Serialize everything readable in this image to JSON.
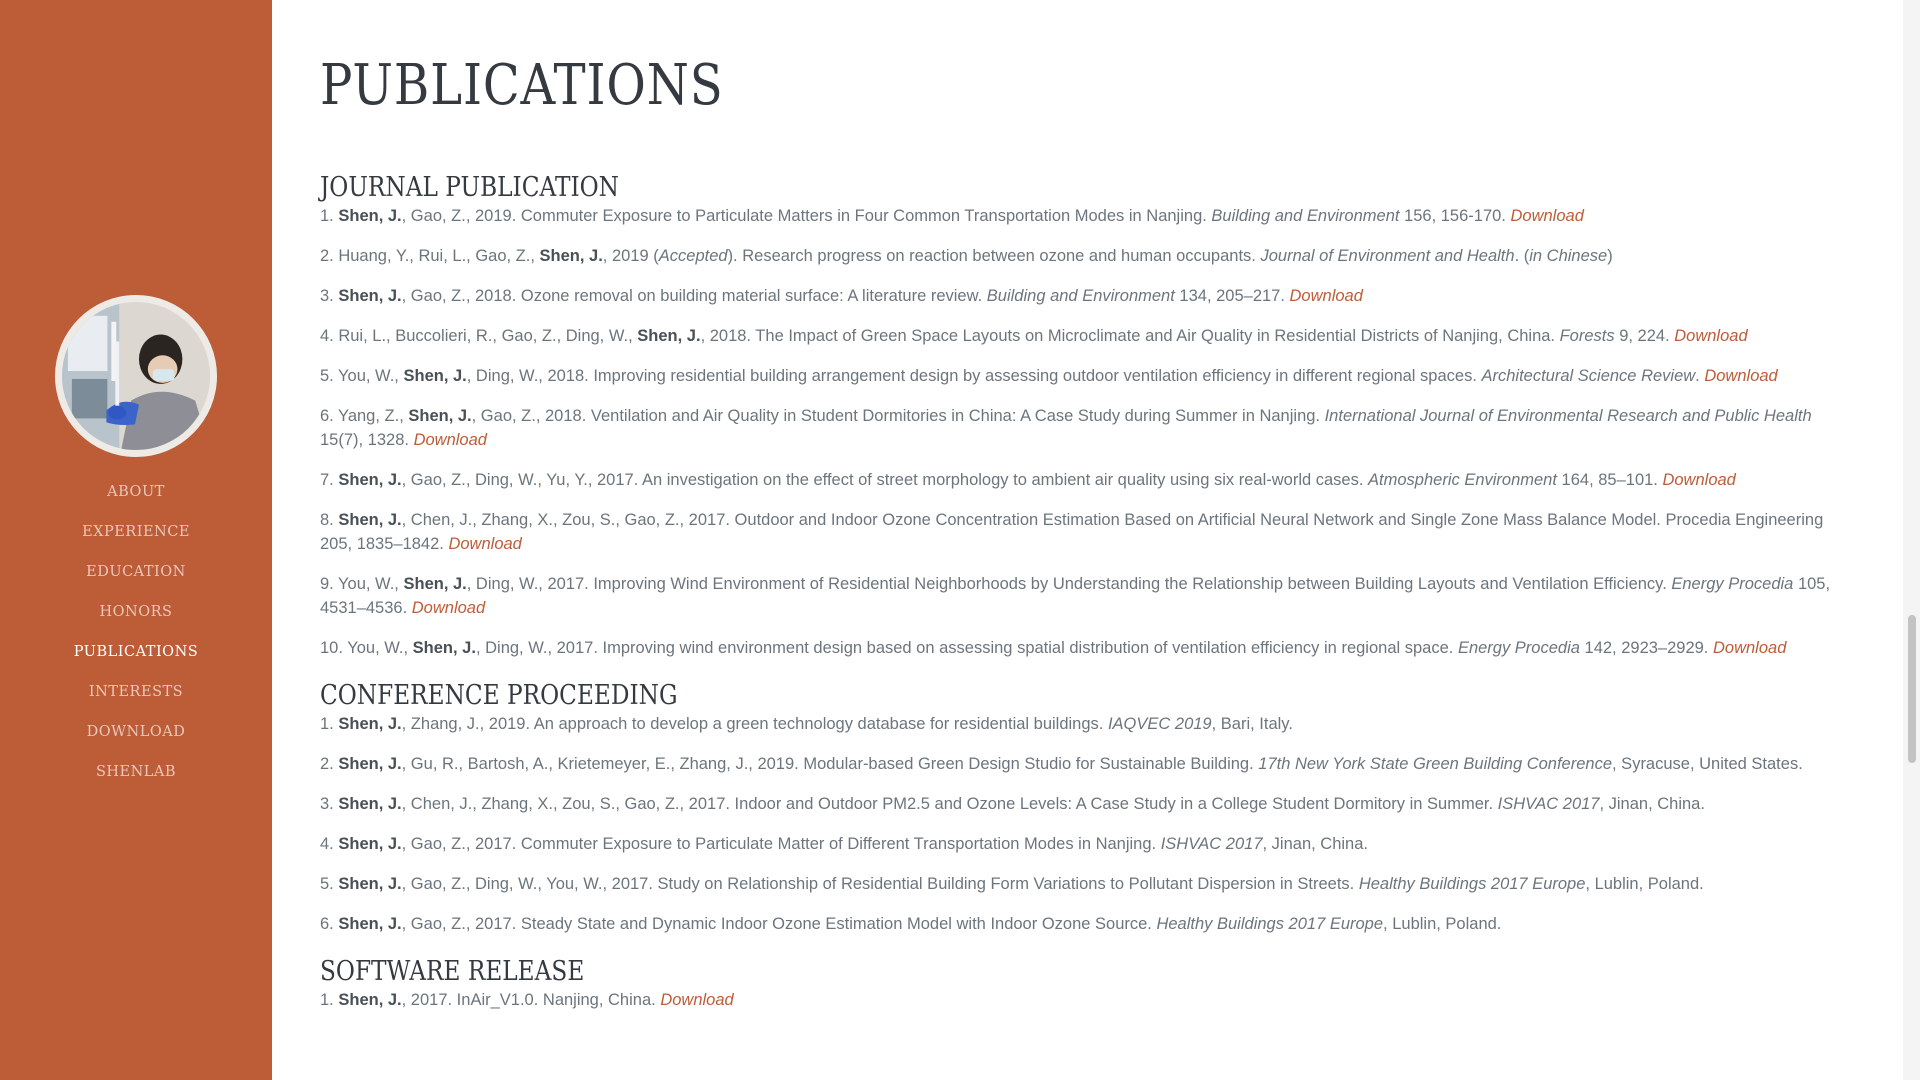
{
  "nav": [
    "ABOUT",
    "EXPERIENCE",
    "EDUCATION",
    "HONORS",
    "PUBLICATIONS",
    "INTERESTS",
    "DOWNLOAD",
    "SHENLAB"
  ],
  "nav_active": "PUBLICATIONS",
  "page_title": "PUBLICATIONS",
  "sections": {
    "journal": {
      "heading": "JOURNAL PUBLICATION",
      "entries": [
        [
          {
            "t": "1. "
          },
          {
            "t": "Shen, J.",
            "s": "author"
          },
          {
            "t": ", Gao, Z., 2019. Commuter Exposure to Particulate Matters in Four Common Transportation Modes in Nanjing. "
          },
          {
            "t": "Building and Environment",
            "s": "i"
          },
          {
            "t": " 156, 156-170. "
          },
          {
            "t": "Download",
            "s": "dl"
          }
        ],
        [
          {
            "t": "2. Huang, Y., Rui, L., Gao, Z., "
          },
          {
            "t": "Shen, J.",
            "s": "author"
          },
          {
            "t": ", 2019 ("
          },
          {
            "t": "Accepted",
            "s": "i"
          },
          {
            "t": "). Research progress on reaction between ozone and human occupants. "
          },
          {
            "t": "Journal of Environment and Health",
            "s": "i"
          },
          {
            "t": ". ("
          },
          {
            "t": "in Chinese",
            "s": "i"
          },
          {
            "t": ")"
          }
        ],
        [
          {
            "t": "3. "
          },
          {
            "t": "Shen, J.",
            "s": "author"
          },
          {
            "t": ", Gao, Z., 2018. Ozone removal on building material surface: A literature review. "
          },
          {
            "t": "Building and Environment",
            "s": "i"
          },
          {
            "t": " 134, 205–217. "
          },
          {
            "t": "Download",
            "s": "dl"
          }
        ],
        [
          {
            "t": "4. Rui, L., Buccolieri, R., Gao, Z., Ding, W., "
          },
          {
            "t": "Shen, J.",
            "s": "author"
          },
          {
            "t": ", 2018. The Impact of Green Space Layouts on Microclimate and Air Quality in Residential Districts of Nanjing, China. "
          },
          {
            "t": "Forests",
            "s": "i"
          },
          {
            "t": " 9, 224. "
          },
          {
            "t": "Download",
            "s": "dl"
          }
        ],
        [
          {
            "t": "5. You, W., "
          },
          {
            "t": "Shen, J.",
            "s": "author"
          },
          {
            "t": ", Ding, W., 2018. Improving residential building arrangement design by assessing outdoor ventilation efficiency in different regional spaces. "
          },
          {
            "t": "Architectural Science Review",
            "s": "i"
          },
          {
            "t": ". "
          },
          {
            "t": "Download",
            "s": "dl"
          }
        ],
        [
          {
            "t": "6. Yang, Z., "
          },
          {
            "t": "Shen, J.",
            "s": "author"
          },
          {
            "t": ", Gao, Z., 2018. Ventilation and Air Quality in Student Dormitories in China: A Case Study during Summer in Nanjing. "
          },
          {
            "t": "International Journal of Environmental Research and Public Health",
            "s": "i"
          },
          {
            "t": " 15(7), 1328. "
          },
          {
            "t": "Download",
            "s": "dl"
          }
        ],
        [
          {
            "t": "7. "
          },
          {
            "t": "Shen, J.",
            "s": "author"
          },
          {
            "t": ", Gao, Z., Ding, W., Yu, Y., 2017. An investigation on the effect of street morphology to ambient air quality using six real-world cases. "
          },
          {
            "t": "Atmospheric Environment",
            "s": "i"
          },
          {
            "t": " 164, 85–101. "
          },
          {
            "t": "Download",
            "s": "dl"
          }
        ],
        [
          {
            "t": "8. "
          },
          {
            "t": "Shen, J.",
            "s": "author"
          },
          {
            "t": ", Chen, J., Zhang, X., Zou, S., Gao, Z., 2017. Outdoor and Indoor Ozone Concentration Estimation Based on Artificial Neural Network and Single Zone Mass Balance Model. Procedia Engineering 205, 1835–1842. "
          },
          {
            "t": "Download",
            "s": "dl"
          }
        ],
        [
          {
            "t": "9. You, W., "
          },
          {
            "t": "Shen, J.",
            "s": "author"
          },
          {
            "t": ", Ding, W., 2017. Improving Wind Environment of Residential Neighborhoods by Understanding the Relationship between Building Layouts and Ventilation Efficiency. "
          },
          {
            "t": "Energy Procedia",
            "s": "i"
          },
          {
            "t": " 105, 4531–4536. "
          },
          {
            "t": "Download",
            "s": "dl"
          }
        ],
        [
          {
            "t": "10. You, W., "
          },
          {
            "t": "Shen, J.",
            "s": "author"
          },
          {
            "t": ", Ding, W., 2017. Improving wind environment design based on assessing spatial distribution of ventilation efficiency in regional space. "
          },
          {
            "t": "Energy Procedia",
            "s": "i"
          },
          {
            "t": " 142, 2923–2929. "
          },
          {
            "t": "Download",
            "s": "dl"
          }
        ]
      ]
    },
    "conference": {
      "heading": "CONFERENCE PROCEEDING",
      "entries": [
        [
          {
            "t": "1. "
          },
          {
            "t": "Shen, J.",
            "s": "author"
          },
          {
            "t": ", Zhang, J., 2019. An approach to develop a green technology database for residential buildings. "
          },
          {
            "t": "IAQVEC 2019",
            "s": "i"
          },
          {
            "t": ", Bari, Italy."
          }
        ],
        [
          {
            "t": "2. "
          },
          {
            "t": "Shen, J.",
            "s": "author"
          },
          {
            "t": ", Gu, R., Bartosh, A., Krietemeyer, E., Zhang, J., 2019. Modular-based Green Design Studio for Sustainable Building. "
          },
          {
            "t": "17th New York State Green Building Conference",
            "s": "i"
          },
          {
            "t": ", Syracuse, United States."
          }
        ],
        [
          {
            "t": "3. "
          },
          {
            "t": "Shen, J.",
            "s": "author"
          },
          {
            "t": ", Chen, J., Zhang, X., Zou, S., Gao, Z., 2017. Indoor and Outdoor PM2.5 and Ozone Levels: A Case Study in a College Student Dormitory in Summer. "
          },
          {
            "t": "ISHVAC 2017",
            "s": "i"
          },
          {
            "t": ", Jinan, China."
          }
        ],
        [
          {
            "t": "4. "
          },
          {
            "t": "Shen, J.",
            "s": "author"
          },
          {
            "t": ", Gao, Z., 2017. Commuter Exposure to Particulate Matter of Different Transportation Modes in Nanjing. "
          },
          {
            "t": "ISHVAC 2017",
            "s": "i"
          },
          {
            "t": ", Jinan, China."
          }
        ],
        [
          {
            "t": "5. "
          },
          {
            "t": "Shen, J.",
            "s": "author"
          },
          {
            "t": ", Gao, Z., Ding, W., You, W., 2017. Study on Relationship of Residential Building Form Variations to Pollutant Dispersion in Streets. "
          },
          {
            "t": "Healthy Buildings 2017 Europe",
            "s": "i"
          },
          {
            "t": ", Lublin, Poland."
          }
        ],
        [
          {
            "t": "6. "
          },
          {
            "t": "Shen, J.",
            "s": "author"
          },
          {
            "t": ", Gao, Z., 2017. Steady State and Dynamic Indoor Ozone Estimation Model with Indoor Ozone Source. "
          },
          {
            "t": "Healthy Buildings 2017 Europe",
            "s": "i"
          },
          {
            "t": ", Lublin, Poland."
          }
        ]
      ]
    },
    "software": {
      "heading": "SOFTWARE RELEASE",
      "entries": [
        [
          {
            "t": "1. "
          },
          {
            "t": "Shen, J.",
            "s": "author"
          },
          {
            "t": ", 2017. InAir_V1.0. Nanjing, China. "
          },
          {
            "t": "Download",
            "s": "dl"
          }
        ]
      ]
    }
  },
  "colors": {
    "sidebar_bg": "#bd5d38",
    "heading": "#343a40",
    "body_text": "#6c757d",
    "link": "#bd5d38"
  },
  "icons": [
    "profile-photo"
  ]
}
